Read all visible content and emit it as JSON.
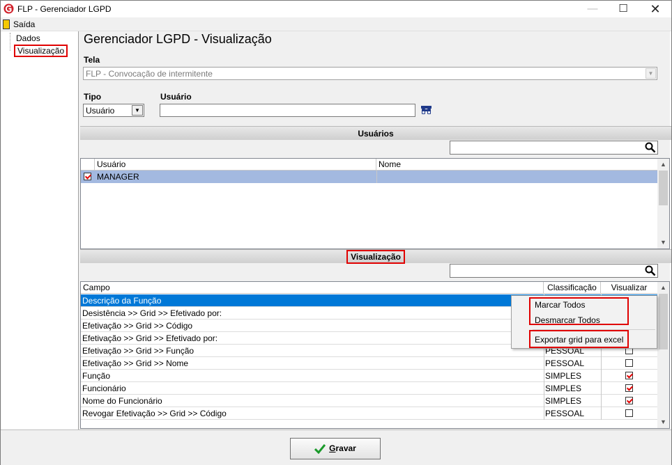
{
  "window": {
    "title": "FLP - Gerenciador LGPD",
    "minimize": "—",
    "maximize": "☐",
    "close": "✕"
  },
  "menu": {
    "saida": "Saída"
  },
  "tree": {
    "dados": "Dados",
    "visualizacao": "Visualização"
  },
  "main": {
    "title": "Gerenciador LGPD - Visualização"
  },
  "form": {
    "tela_label": "Tela",
    "tela_value": "FLP - Convocação de intermitente",
    "tipo_label": "Tipo",
    "tipo_value": "Usuário",
    "usuario_label": "Usuário",
    "usuario_value": ""
  },
  "usuarios_section": {
    "header": "Usuários",
    "search_value": "",
    "columns": [
      "",
      "Usuário",
      "Nome"
    ],
    "rows": [
      {
        "checked": true,
        "usuario": "MANAGER",
        "nome": ""
      }
    ]
  },
  "visualizacao_section": {
    "header": "Visualização",
    "search_value": "",
    "columns": [
      "Campo",
      "Classificação",
      "Visualizar"
    ],
    "rows": [
      {
        "campo": "Descrição da Função",
        "classificacao": "",
        "visualizar": null,
        "selected": true
      },
      {
        "campo": "Desistência >> Grid >> Efetivado por:",
        "classificacao": "",
        "visualizar": null,
        "selected": false
      },
      {
        "campo": "Efetivação >> Grid >> Código",
        "classificacao": "",
        "visualizar": null,
        "selected": false
      },
      {
        "campo": "Efetivação >> Grid >> Efetivado por:",
        "classificacao": "",
        "visualizar": null,
        "selected": false
      },
      {
        "campo": "Efetivação >> Grid >> Função",
        "classificacao": "PESSOAL",
        "visualizar": false,
        "selected": false
      },
      {
        "campo": "Efetivação >> Grid >> Nome",
        "classificacao": "PESSOAL",
        "visualizar": false,
        "selected": false
      },
      {
        "campo": "Função",
        "classificacao": "SIMPLES",
        "visualizar": true,
        "selected": false
      },
      {
        "campo": "Funcionário",
        "classificacao": "SIMPLES",
        "visualizar": true,
        "selected": false
      },
      {
        "campo": "Nome do Funcionário",
        "classificacao": "SIMPLES",
        "visualizar": true,
        "selected": false
      },
      {
        "campo": "Revogar Efetivação >> Grid >> Código",
        "classificacao": "PESSOAL",
        "visualizar": false,
        "selected": false
      }
    ]
  },
  "context_menu": {
    "marcar_todos": "Marcar Todos",
    "desmarcar_todos": "Desmarcar Todos",
    "exportar": "Exportar grid para excel"
  },
  "footer": {
    "gravar_first": "G",
    "gravar_rest": "ravar"
  },
  "colors": {
    "selection": "#0078d7",
    "row_highlight": "#a3b9e0",
    "annotation": "#e00000",
    "check": "#e00000"
  }
}
